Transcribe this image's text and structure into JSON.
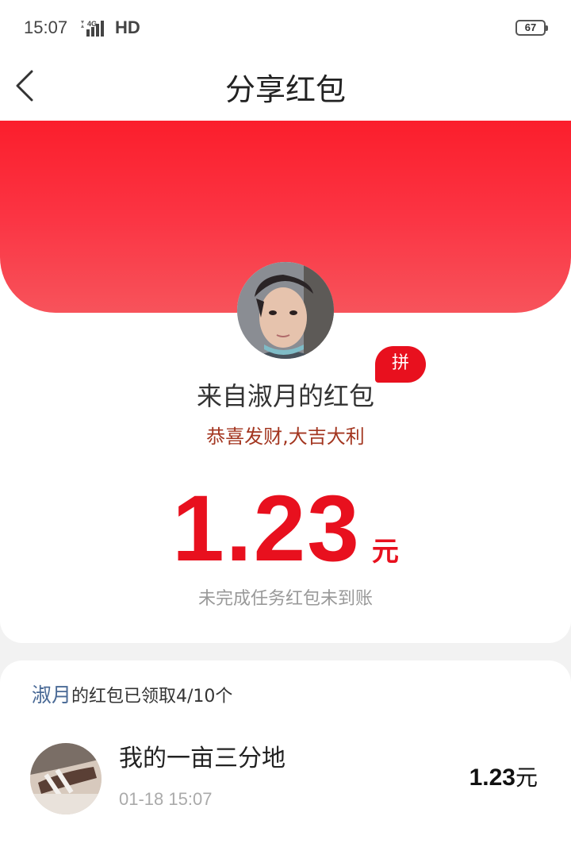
{
  "status_bar": {
    "time": "15:07",
    "network": "4G",
    "hd": "HD",
    "battery": "67"
  },
  "nav": {
    "title": "分享红包",
    "back_icon": "chevron-left-icon"
  },
  "red_packet": {
    "from_title": "来自淑月的红包",
    "badge": "拼",
    "greeting": "恭喜发财,大吉大利",
    "amount": "1.23",
    "unit": "元",
    "status_note": "未完成任务红包未到账"
  },
  "claims": {
    "owner": "淑月",
    "summary": "的红包已领取4/10个",
    "items": [
      {
        "name": "我的一亩三分地",
        "time": "01-18 15:07",
        "amount": "1.23",
        "unit": "元"
      }
    ]
  },
  "colors": {
    "accent": "#e8101e",
    "hero_top": "#fb1e2c",
    "hero_bottom": "#f7535b",
    "greeting": "#a33620",
    "owner_name": "#4a6a96"
  }
}
